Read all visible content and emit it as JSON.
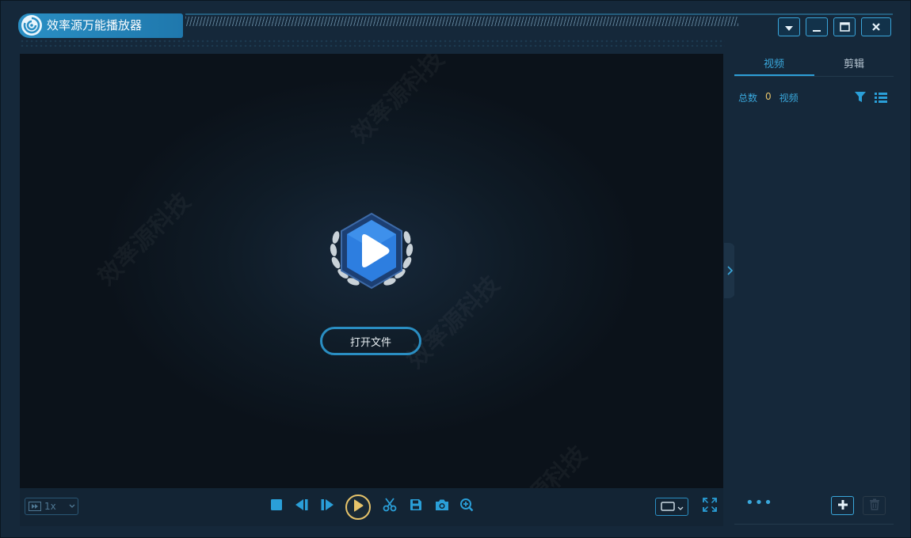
{
  "app": {
    "title": "效率源万能播放器"
  },
  "watermark": {
    "text": "效率源科技"
  },
  "window_controls": {
    "menu_icon": "caret-down-icon",
    "minimize_icon": "minimize-icon",
    "maximize_icon": "maximize-icon",
    "close_icon": "close-icon"
  },
  "player": {
    "open_file_label": "打开文件"
  },
  "controls": {
    "speed": "1x",
    "icons": [
      "stop-icon",
      "previous-frame-icon",
      "next-frame-icon",
      "play-icon",
      "cut-icon",
      "save-icon",
      "screenshot-icon",
      "zoom-icon",
      "aspect-ratio-icon",
      "fullscreen-icon"
    ]
  },
  "side_panel": {
    "tabs": [
      {
        "label": "视频",
        "active": true
      },
      {
        "label": "剪辑",
        "active": false
      }
    ],
    "total_label": "总数",
    "total_count": "0",
    "total_unit": "视频",
    "more_label": "•••"
  },
  "colors": {
    "accent": "#2a9fd8",
    "play_ring": "#e6c36a",
    "background": "#15283a",
    "video_bg": "#0f1b26"
  }
}
